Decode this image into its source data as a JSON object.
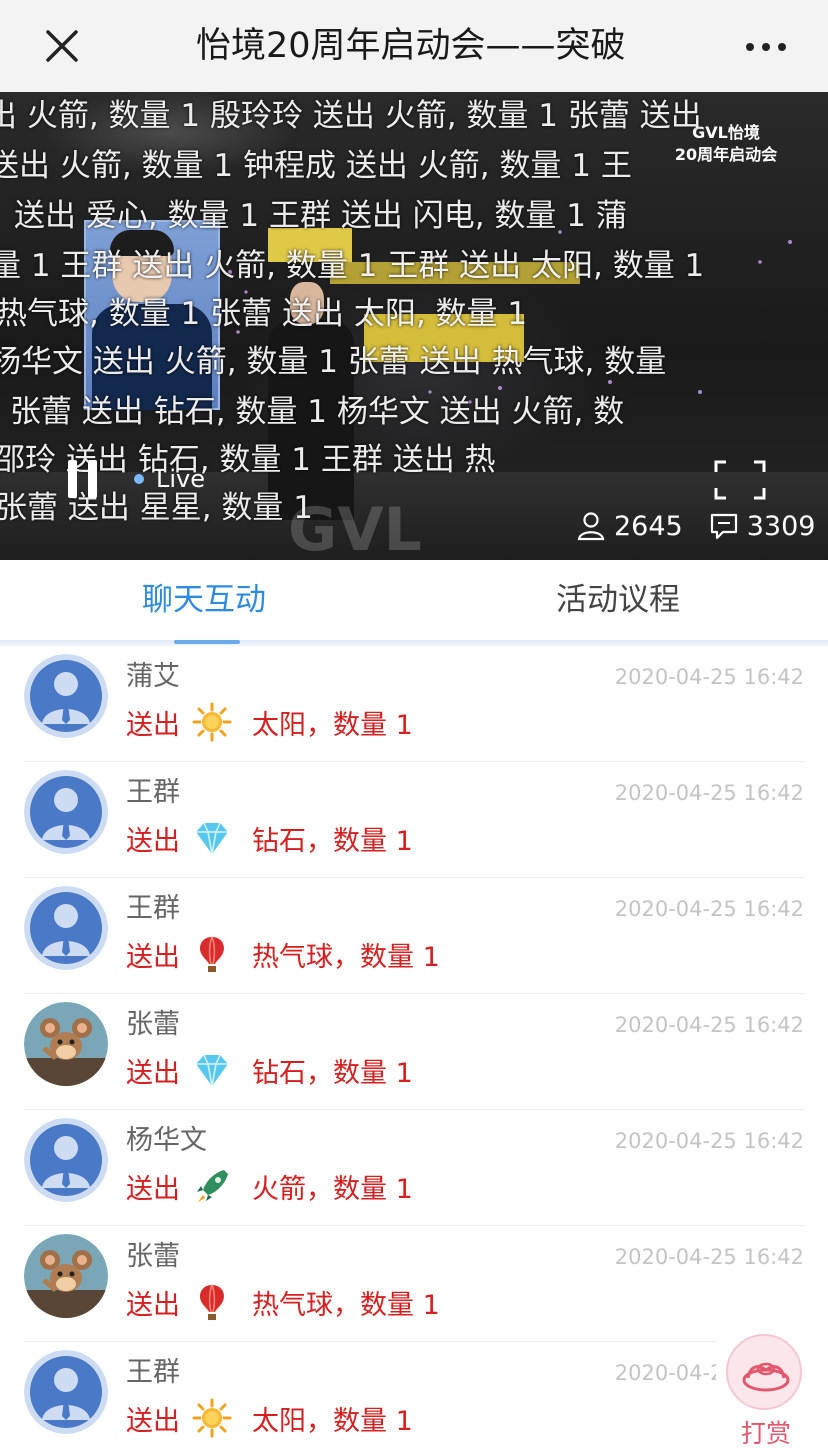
{
  "header": {
    "title": "怡境20周年启动会——突破",
    "close_icon": "close-icon",
    "more_icon": "more-dots-icon"
  },
  "video": {
    "logo_line1": "GVL怡境",
    "logo_line2": "20周年启动会",
    "watermark": "GVL",
    "live_label": "Live",
    "viewers": "2645",
    "comments": "3309",
    "danmaku": [
      "出 火箭, 数量 1  殷玲玲 送出 火箭, 数量 1     张蕾 送出",
      "送出 火箭, 数量 1      钟程成 送出 火箭, 数量 1              王",
      "送出 爱心, 数量 1       王群 送出 闪电, 数量 1                蒲",
      "量 1       王群 送出 火箭, 数量 1 王群 送出 太阳, 数量 1",
      "热气球, 数量 1              张蕾 送出 太阳, 数量 1",
      "杨华文 送出 火箭, 数量 1              张蕾 送出 热气球, 数量",
      "  张蕾 送出 钻石, 数量 1                  杨华文 送出 火箭, 数",
      "                  邵玲 送出 钻石, 数量 1              王群 送出 热",
      "                  张蕾 送出 星星, 数量 1"
    ]
  },
  "tabs": [
    {
      "label": "聊天互动",
      "active": true
    },
    {
      "label": "活动议程",
      "active": false
    }
  ],
  "colors": {
    "accent": "#2e8be0",
    "gift_text": "#d42020",
    "time_text": "#c4c4c4",
    "reward": "#e2576e"
  },
  "messages": [
    {
      "name": "蒲艾",
      "time": "2020-04-25 16:42",
      "verb": "送出",
      "gift": "太阳，数量 1",
      "icon": "sun-icon",
      "avatar": "default-avatar"
    },
    {
      "name": "王群",
      "time": "2020-04-25 16:42",
      "verb": "送出",
      "gift": "钻石，数量 1",
      "icon": "diamond-icon",
      "avatar": "default-avatar"
    },
    {
      "name": "王群",
      "time": "2020-04-25 16:42",
      "verb": "送出",
      "gift": "热气球，数量 1",
      "icon": "hot-air-balloon-icon",
      "avatar": "default-avatar"
    },
    {
      "name": "张蕾",
      "time": "2020-04-25 16:42",
      "verb": "送出",
      "gift": "钻石，数量 1",
      "icon": "diamond-icon",
      "avatar": "cartoon-mouse-avatar"
    },
    {
      "name": "杨华文",
      "time": "2020-04-25 16:42",
      "verb": "送出",
      "gift": "火箭，数量 1",
      "icon": "rocket-icon",
      "avatar": "default-avatar"
    },
    {
      "name": "张蕾",
      "time": "2020-04-25 16:42",
      "verb": "送出",
      "gift": "热气球，数量 1",
      "icon": "hot-air-balloon-icon",
      "avatar": "cartoon-mouse-avatar"
    },
    {
      "name": "王群",
      "time": "2020-04-25 16:42",
      "verb": "送出",
      "gift": "太阳，数量 1",
      "icon": "sun-icon",
      "avatar": "default-avatar"
    }
  ],
  "reward": {
    "label": "打赏",
    "icon": "gold-ingot-icon"
  }
}
